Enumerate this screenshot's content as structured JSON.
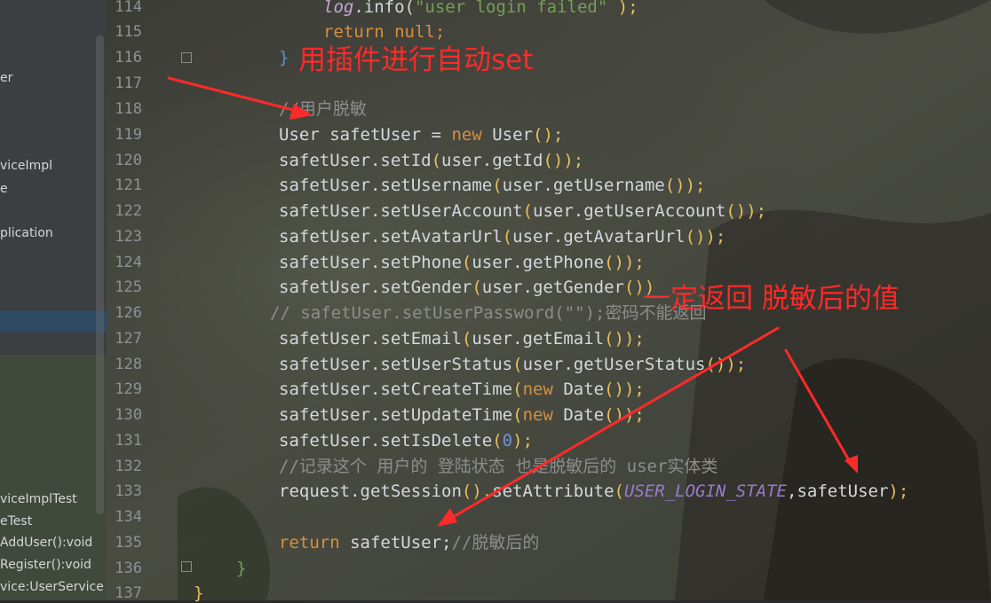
{
  "sidebar": {
    "items": [
      "er",
      "viceImpl",
      "e",
      "plication",
      "viceImplTest",
      "eTest",
      "AddUser():void",
      "Register():void",
      "vice:UserService"
    ]
  },
  "line_numbers": [
    "114",
    "115",
    "116",
    "117",
    "118",
    "119",
    "120",
    "121",
    "122",
    "123",
    "124",
    "125",
    "126",
    "127",
    "128",
    "129",
    "130",
    "131",
    "132",
    "133",
    "134",
    "135",
    "136",
    "137"
  ],
  "code": {
    "l114": {
      "logv": "log",
      "dot": ".info(",
      "str": "\"user login failed\"",
      "end": " );"
    },
    "l115": {
      "kw": "return",
      "rest": " null;"
    },
    "l116": "}",
    "l118": "//用户脱敏",
    "l119": {
      "a": "User safetUser = ",
      "kw": "new",
      "b": " User",
      "p": "();"
    },
    "l120": {
      "a": "safetUser.setId",
      "p1": "(",
      "b": "user.getId",
      "p2": "());"
    },
    "l121": {
      "a": "safetUser.setUsername",
      "p1": "(",
      "b": "user.getUsername",
      "p2": "());"
    },
    "l122": {
      "a": "safetUser.setUserAccount",
      "p1": "(",
      "b": "user.getUserAccount",
      "p2": "());"
    },
    "l123": {
      "a": "safetUser.setAvatarUrl",
      "p1": "(",
      "b": "user.getAvatarUrl",
      "p2": "());"
    },
    "l124": {
      "a": "safetUser.setPhone",
      "p1": "(",
      "b": "user.getPhone",
      "p2": "());"
    },
    "l125": {
      "a": "safetUser.setGender",
      "p1": "(",
      "b": "user.getGender",
      "p2": "())"
    },
    "l126": "// safetUser.setUserPassword(\"\");密码不能返回",
    "l127": {
      "a": "safetUser.setEmail",
      "p1": "(",
      "b": "user.getEmail",
      "p2": "());"
    },
    "l128": {
      "a": "safetUser.setUserStatus",
      "p1": "(",
      "b": "user.getUserStatus",
      "p2": "());"
    },
    "l129": {
      "a": "safetUser.setCreateTime",
      "p1": "(",
      "kw": "new",
      "b": " Date",
      "p2": "());"
    },
    "l130": {
      "a": "safetUser.setUpdateTime",
      "p1": "(",
      "kw": "new",
      "b": " Date",
      "p2": "());"
    },
    "l131": {
      "a": "safetUser.setIsDelete",
      "p1": "(",
      "num": "0",
      "p2": ");"
    },
    "l132": "//记录这个 用户的 登陆状态 也是脱敏后的 user实体类",
    "l133": {
      "a": "request.getSession",
      "p1": "().",
      "b": "setAttribute",
      "p2": "(",
      "field": "USER_LOGIN_STATE",
      "c": ",safetUser",
      "p3": ");"
    },
    "l135": {
      "kw": "return",
      "rest": " safetUser;",
      "cmt": "//脱敏后的"
    },
    "l136": "}",
    "l137": "}"
  },
  "annotations": {
    "top": "用插件进行自动set",
    "right": "一定返回 脱敏后的值"
  },
  "colors": {
    "annotation": "#ff2a2a",
    "keyword": "#d78f3c",
    "comment": "#8d8d8d"
  }
}
